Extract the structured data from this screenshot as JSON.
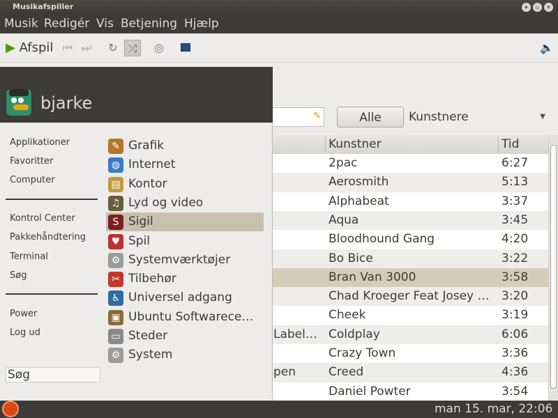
{
  "window": {
    "title": "Musikafspiller"
  },
  "menubar": [
    "Musik",
    "Redigér",
    "Vis",
    "Betjening",
    "Hjælp"
  ],
  "toolbar": {
    "play_label": "Afspil"
  },
  "browser": {
    "all_button": "Alle",
    "view_select": "Kunstnere"
  },
  "table": {
    "headers": [
      "Kunstner",
      "Tid"
    ],
    "rows": [
      {
        "c1": "",
        "artist": "2pac",
        "time": "6:27"
      },
      {
        "c1": "",
        "artist": "Aerosmith",
        "time": "5:13"
      },
      {
        "c1": "",
        "artist": "Alphabeat",
        "time": "3:37"
      },
      {
        "c1": "",
        "artist": "Aqua",
        "time": "3:45"
      },
      {
        "c1": "",
        "artist": "Bloodhound Gang",
        "time": "4:20"
      },
      {
        "c1": "",
        "artist": "Bo Bice",
        "time": "3:22"
      },
      {
        "c1": "",
        "artist": "Bran Van 3000",
        "time": "3:58"
      },
      {
        "c1": "",
        "artist": "Chad Kroeger Feat Josey …",
        "time": "3:20"
      },
      {
        "c1": "",
        "artist": "Cheek",
        "time": "3:19"
      },
      {
        "c1": " Label…",
        "artist": "Coldplay",
        "time": "6:06"
      },
      {
        "c1": "",
        "artist": "Crazy Town",
        "time": "3:36"
      },
      {
        "c1": "pen",
        "artist": "Creed",
        "time": "4:36"
      },
      {
        "c1": "",
        "artist": "Daniel Powter",
        "time": "3:54"
      }
    ]
  },
  "menu_panel": {
    "user": "bjarke",
    "links_group1": [
      "Applikationer",
      "Favoritter",
      "Computer"
    ],
    "links_group2": [
      "Kontrol Center",
      "Pakkehåndtering",
      "Terminal",
      "Søg"
    ],
    "links_group3": [
      "Power",
      "Log ud"
    ],
    "search_value": "Søg",
    "categories": [
      {
        "label": "Grafik",
        "icon": "graphics-icon"
      },
      {
        "label": "Internet",
        "icon": "globe-icon"
      },
      {
        "label": "Kontor",
        "icon": "office-icon"
      },
      {
        "label": "Lyd og video",
        "icon": "music-icon"
      },
      {
        "label": "Sigil",
        "icon": "sigil-icon"
      },
      {
        "label": "Spil",
        "icon": "cards-icon"
      },
      {
        "label": "Systemværktøjer",
        "icon": "gear-icon"
      },
      {
        "label": "Tilbehør",
        "icon": "tools-icon"
      },
      {
        "label": "Universel adgang",
        "icon": "accessibility-icon"
      },
      {
        "label": "Ubuntu Softwarece…",
        "icon": "software-center-icon"
      },
      {
        "label": "Steder",
        "icon": "drive-icon"
      },
      {
        "label": "System",
        "icon": "gear-icon"
      }
    ]
  },
  "clock": "man 15. mar, 22:06"
}
